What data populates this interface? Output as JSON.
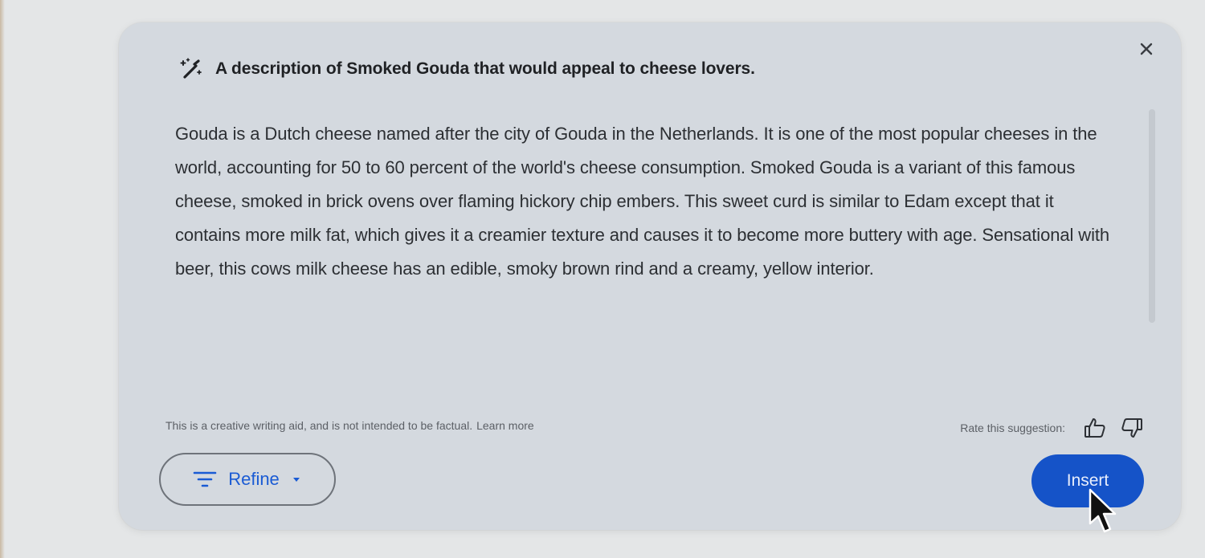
{
  "dialog": {
    "prompt": "A description of Smoked Gouda that would appeal to cheese lovers.",
    "body": "Gouda is a Dutch cheese named after the city of Gouda in the Netherlands. It is one of the most popular cheeses in the world, accounting for 50 to 60 percent of the world's cheese consumption. Smoked Gouda is a variant of this famous cheese, smoked in brick ovens over flaming hickory chip embers. This sweet curd is similar to Edam except that it contains more milk fat, which gives it a creamier texture and causes it to become more buttery with age. Sensational with beer, this cows milk cheese has an edible, smoky brown rind and a creamy, yellow interior.",
    "disclaimer": "This is a creative writing aid, and is not intended to be factual.",
    "learn_more": "Learn more",
    "rate_label": "Rate this suggestion:",
    "refine_label": "Refine",
    "insert_label": "Insert"
  },
  "icons": {
    "prompt": "magic-wand-icon",
    "close": "close-icon",
    "thumbs_up": "thumbs-up-icon",
    "thumbs_down": "thumbs-down-icon",
    "refine": "filter-lines-icon",
    "dropdown": "caret-down-icon",
    "cursor": "mouse-pointer-icon"
  },
  "colors": {
    "accent": "#1a5bd4",
    "insert_bg": "#1553c8",
    "card_bg": "#d4d9df",
    "page_bg": "#e4e6e7"
  }
}
